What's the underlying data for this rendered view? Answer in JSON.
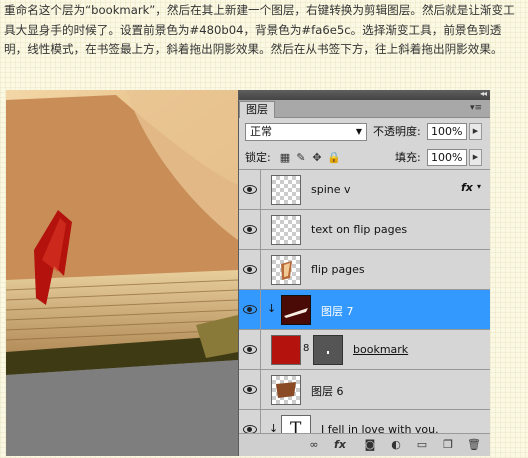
{
  "intro_text": "重命名这个层为“bookmark”，然后在其上新建一个图层，右键转换为剪辑图层。然后就是让渐变工具大显身手的时候了。设置前景色为#480b04，背景色为#fa6e5c。选择渐变工具，前景色到透明，线性模式，在书签最上方，斜着拖出阴影效果。然后在从书签下方，往上斜着拖出阴影效果。",
  "colors": {
    "foreground": "#480b04",
    "background": "#fa6e5c",
    "selection": "#3399ff"
  },
  "panel": {
    "tab_label": "图层",
    "collapse_glyph": "◂◂",
    "menu_glyph": "▾≡",
    "blend_mode": "正常",
    "opacity_label": "不透明度:",
    "opacity_value": "100%",
    "lock_label": "锁定:",
    "fill_label": "填充:",
    "fill_value": "100%",
    "lock_icons": [
      "transparency-lock-icon",
      "brush-lock-icon",
      "move-lock-icon",
      "padlock-icon"
    ],
    "fx_glyph": "fx",
    "clip_glyph": "↓",
    "link_glyph": "8",
    "layers": [
      {
        "name": "spine v",
        "thumb": "transparent",
        "fx": true
      },
      {
        "name": "text on flip pages",
        "thumb": "transparent"
      },
      {
        "name": "flip pages",
        "thumb": "pages"
      },
      {
        "name": "图层 7",
        "thumb": "dark-red",
        "selected": true,
        "clipped": true
      },
      {
        "name": "bookmark",
        "thumb": "red",
        "has_mask": true
      },
      {
        "name": "图层 6",
        "thumb": "brown"
      },
      {
        "name": "I fell in love with you.",
        "thumb": "text",
        "text_glyph": "T",
        "clipped": true
      }
    ],
    "bottom_icons": [
      "link-icon",
      "fx-icon",
      "mask-icon",
      "adjustment-icon",
      "folder-icon",
      "new-layer-icon",
      "trash-icon"
    ],
    "bottom_glyphs": [
      "∞",
      "fx",
      "◙",
      "◐",
      "▭",
      "❐",
      "🗑"
    ]
  }
}
